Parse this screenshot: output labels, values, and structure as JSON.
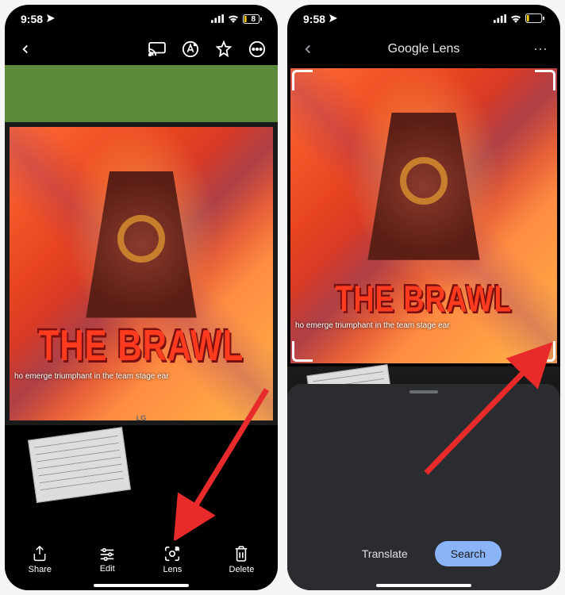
{
  "status": {
    "time": "9:58",
    "battery": "8"
  },
  "photos_viewer": {
    "toolbar": {
      "share": "Share",
      "edit": "Edit",
      "lens": "Lens",
      "delete": "Delete"
    }
  },
  "lens": {
    "title_brand": "Google",
    "title_app": "Lens",
    "actions": {
      "translate": "Translate",
      "search": "Search"
    }
  },
  "artwork": {
    "title_text": "THE BRAWL",
    "subtitle": "ho emerge triumphant in the team stage ear",
    "monitor_brand": "LG"
  }
}
